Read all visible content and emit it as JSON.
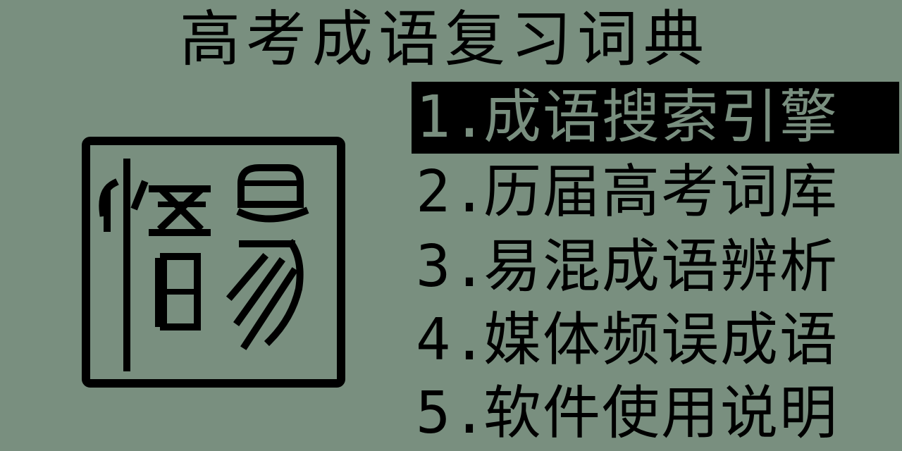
{
  "app": {
    "title": "高考成语复习词典",
    "colors": {
      "background": "#798f7f",
      "foreground": "#000000"
    }
  },
  "logo": {
    "icon": "seal-stamp-icon",
    "text": "悟易"
  },
  "menu": {
    "selected_index": 0,
    "items": [
      {
        "number": "1.",
        "label": "成语搜索引擎"
      },
      {
        "number": "2.",
        "label": "历届高考词库"
      },
      {
        "number": "3.",
        "label": "易混成语辨析"
      },
      {
        "number": "4.",
        "label": "媒体频误成语"
      },
      {
        "number": "5.",
        "label": "软件使用说明"
      }
    ]
  }
}
